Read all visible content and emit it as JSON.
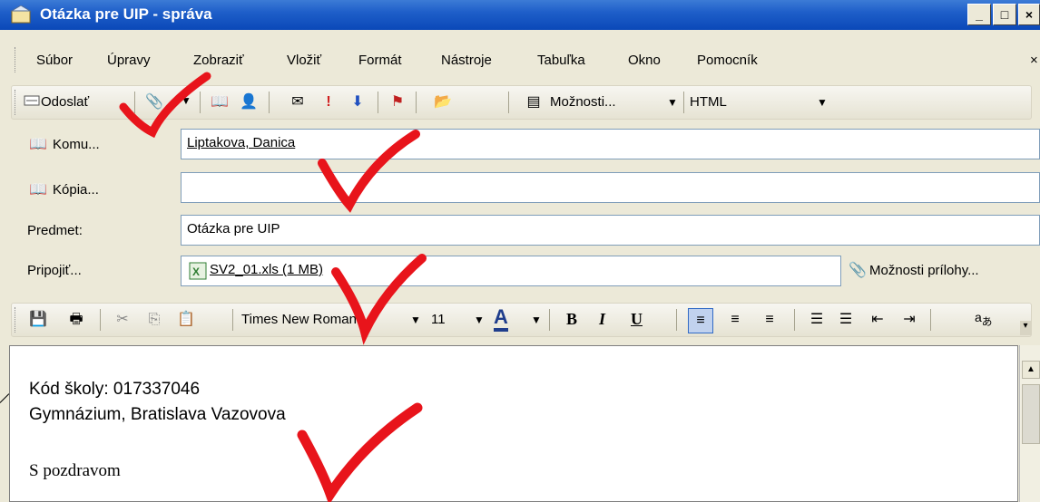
{
  "window": {
    "title": "Otázka pre UIP - správa"
  },
  "menu": [
    "Súbor",
    "Úpravy",
    "Zobraziť",
    "Vložiť",
    "Formát",
    "Nástroje",
    "Tabuľka",
    "Okno",
    "Pomocník"
  ],
  "toolbar": {
    "send_label": "Odoslať",
    "options_label": "Možnosti...",
    "format_value": "HTML"
  },
  "header": {
    "to_button": "Komu...",
    "to_value": "Liptakova, Danica",
    "cc_button": "Kópia...",
    "cc_value": "",
    "subject_label": "Predmet:",
    "subject_value": "Otázka pre UIP",
    "attach_label": "Pripojiť...",
    "attachment": "SV2_01.xls (1 MB)",
    "attach_options": "Možnosti prílohy..."
  },
  "format_toolbar": {
    "font": "Times New Roman",
    "size": "11",
    "bold": "B",
    "italic": "I",
    "underline": "U"
  },
  "body": {
    "line1": "Kód školy: 017337046",
    "line2": "Gymnázium, Bratislava Vazovova",
    "line3": "S pozdravom"
  },
  "colors": {
    "titlebar": "#0a48b8",
    "checkmark": "#e8141b"
  }
}
